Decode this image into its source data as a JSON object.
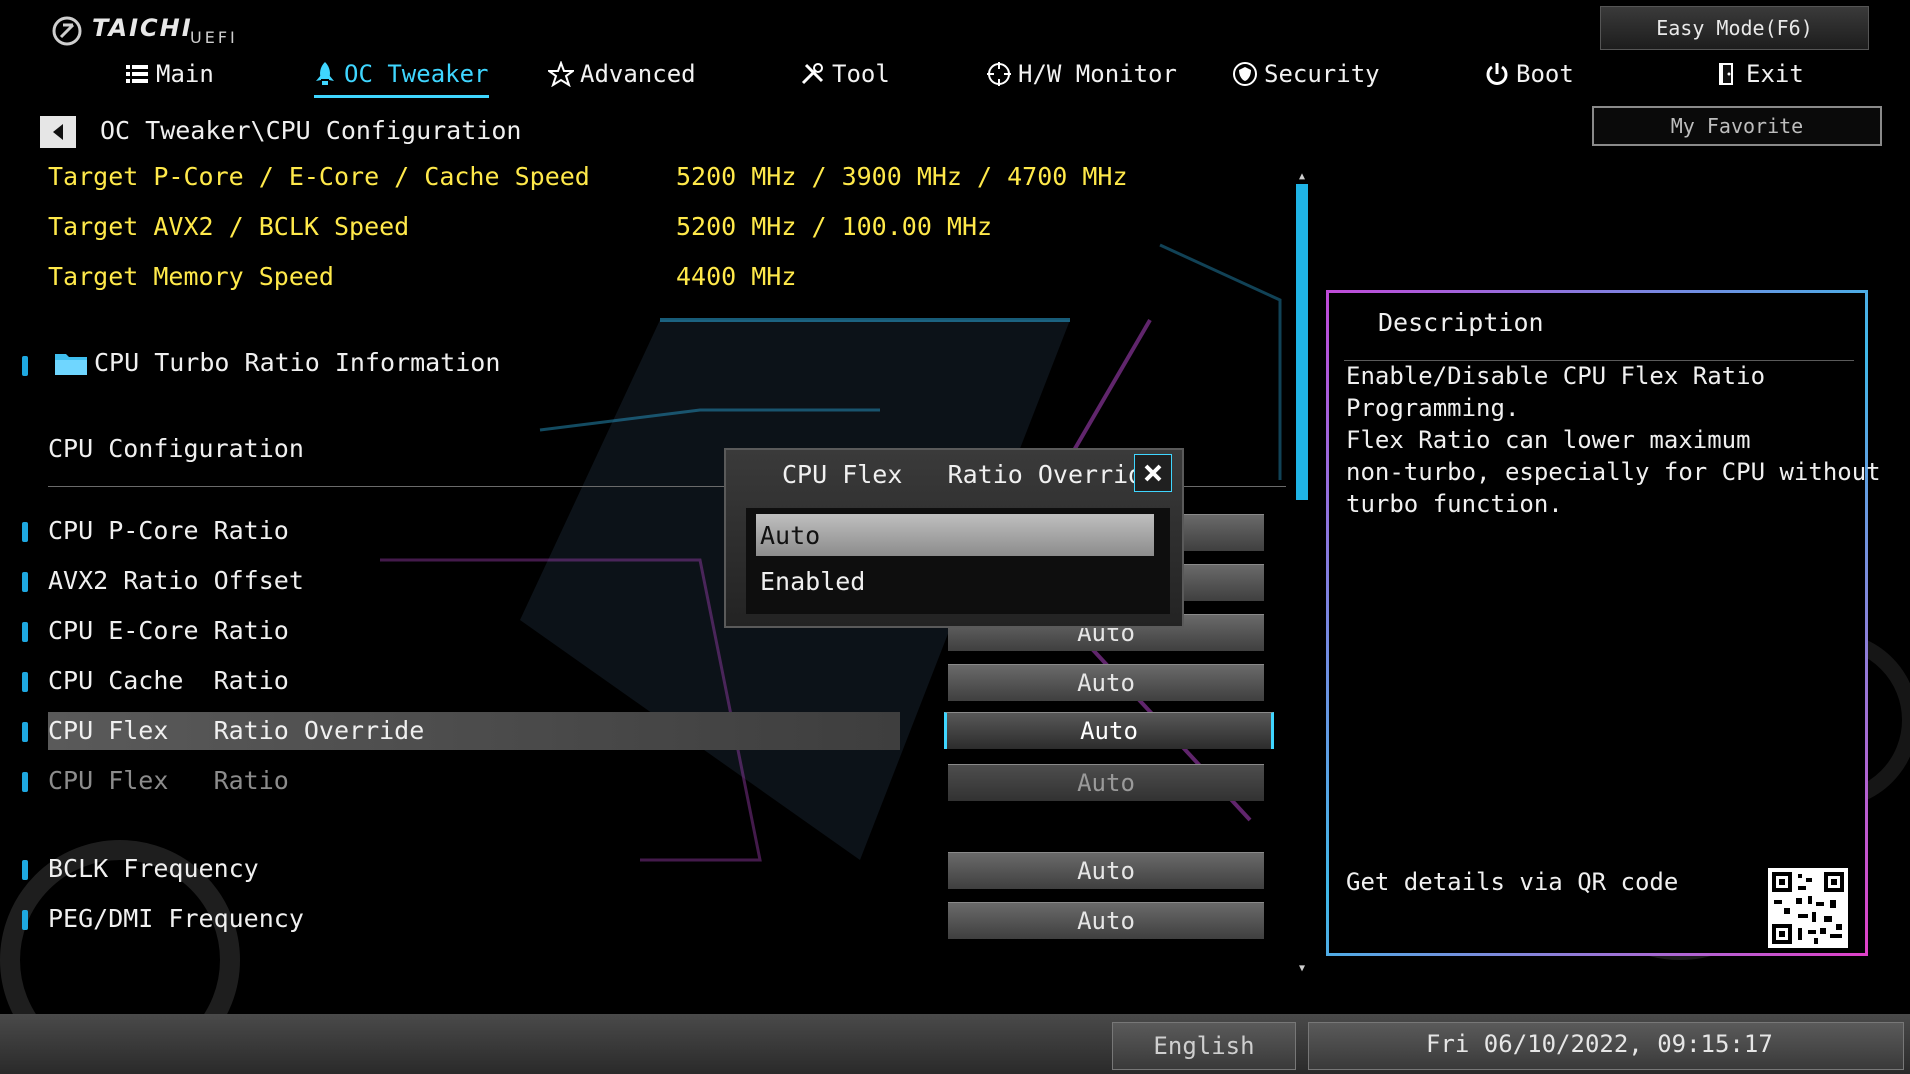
{
  "brand": {
    "name": "TAICHI",
    "sub": "UEFI"
  },
  "header": {
    "tabs": [
      {
        "label": "Main",
        "icon": "list-icon"
      },
      {
        "label": "OC Tweaker",
        "icon": "rocket-icon",
        "active": true
      },
      {
        "label": "Advanced",
        "icon": "star-icon"
      },
      {
        "label": "Tool",
        "icon": "tools-icon"
      },
      {
        "label": "H/W Monitor",
        "icon": "crosshair-icon"
      },
      {
        "label": "Security",
        "icon": "shield-icon"
      },
      {
        "label": "Boot",
        "icon": "power-icon"
      },
      {
        "label": "Exit",
        "icon": "exit-door-icon"
      }
    ],
    "easy_mode": "Easy Mode(F6)",
    "my_favorite": "My Favorite"
  },
  "breadcrumb": "OC Tweaker\\CPU Configuration",
  "targets": [
    {
      "label": "Target P-Core / E-Core / Cache Speed",
      "value": "5200 MHz / 3900 MHz / 4700 MHz"
    },
    {
      "label": "Target AVX2 / BCLK Speed",
      "value": "5200 MHz / 100.00 MHz"
    },
    {
      "label": "Target Memory Speed",
      "value": "4400 MHz"
    }
  ],
  "submenu": {
    "label": "CPU Turbo Ratio Information",
    "icon": "folder-icon"
  },
  "section_title": "CPU Configuration",
  "items": [
    {
      "label": "CPU P-Core Ratio",
      "value": ""
    },
    {
      "label": "AVX2 Ratio Offset",
      "value": ""
    },
    {
      "label": "CPU E-Core Ratio",
      "value": "Auto"
    },
    {
      "label": "CPU Cache  Ratio",
      "value": "Auto"
    },
    {
      "label": "CPU Flex   Ratio Override",
      "value": "Auto"
    },
    {
      "label": "CPU Flex   Ratio",
      "value": "Auto"
    },
    {
      "label": "BCLK Frequency",
      "value": "Auto"
    },
    {
      "label": "PEG/DMI Frequency",
      "value": "Auto"
    }
  ],
  "popup": {
    "title": "CPU Flex   Ratio Override",
    "options": [
      "Auto",
      "Enabled"
    ],
    "selected": "Auto"
  },
  "description": {
    "title": "Description",
    "lines": [
      "Enable/Disable CPU Flex Ratio",
      "Programming.",
      "Flex Ratio can lower maximum",
      "non-turbo, especially for CPU without",
      "turbo function."
    ],
    "qr_label": "Get details via QR code"
  },
  "footer": {
    "language": "English",
    "datetime": "Fri 06/10/2022, 09:15:17"
  },
  "colors": {
    "accent": "#3fd6ff",
    "target_text": "#ffe94a",
    "bullet": "#1ea8e0"
  }
}
